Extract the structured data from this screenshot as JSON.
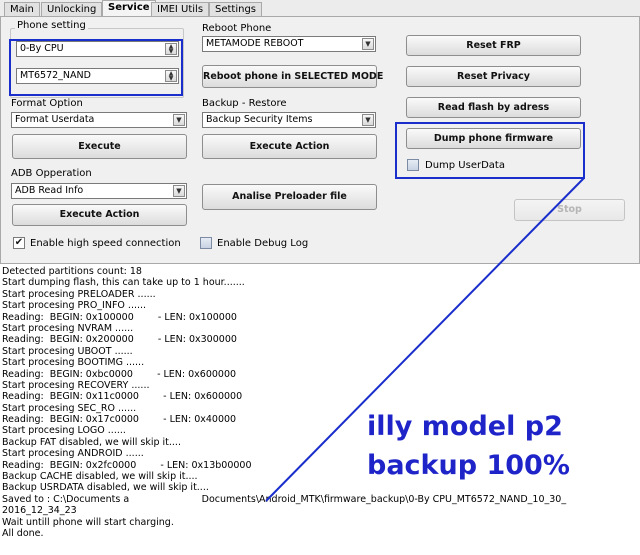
{
  "tabs": [
    "Main",
    "Unlocking",
    "Service",
    "IMEI Utils",
    "Settings"
  ],
  "phone_setting": {
    "title": "Phone setting",
    "cpu_value": "0-By CPU",
    "chip_value": "MT6572_NAND"
  },
  "reboot": {
    "title": "Reboot Phone",
    "mode_value": "METAMODE REBOOT",
    "button": "Reboot phone in SELECTED MODE"
  },
  "format": {
    "title": "Format Option",
    "value": "Format Userdata",
    "button": "Execute"
  },
  "backup": {
    "title": "Backup - Restore",
    "value": "Backup Security Items",
    "button": "Execute Action"
  },
  "adb": {
    "title": "ADB Opperation",
    "value": "ADB Read Info",
    "button": "Execute Action"
  },
  "preloader": {
    "button": "Analise Preloader file"
  },
  "right_buttons": {
    "reset_frp": "Reset FRP",
    "reset_privacy": "Reset Privacy",
    "read_flash": "Read flash by adress",
    "dump_firmware": "Dump phone firmware"
  },
  "dump_userdata": {
    "label": "Dump UserData",
    "checked": false
  },
  "stop": "Stop",
  "high_speed": {
    "label": "Enable high speed connection",
    "checked": true
  },
  "debug_log": {
    "label": "Enable Debug Log",
    "checked": false
  },
  "log": [
    "Detected partitions count: 18",
    "Start dumping flash, this can take up to 1 hour.......",
    "Start procesing PRELOADER ......",
    "Start procesing PRO_INFO ......",
    "Reading:  BEGIN: 0x100000        - LEN: 0x100000",
    "Start procesing NVRAM ......",
    "Reading:  BEGIN: 0x200000        - LEN: 0x300000",
    "Start procesing UBOOT ......",
    "Start procesing BOOTIMG ......",
    "Reading:  BEGIN: 0xbc0000        - LEN: 0x600000",
    "Start procesing RECOVERY ......",
    "Reading:  BEGIN: 0x11c0000        - LEN: 0x600000",
    "Start procesing SEC_RO ......",
    "Reading:  BEGIN: 0x17c0000        - LEN: 0x40000",
    "Start procesing LOGO ......",
    "Backup FAT disabled, we will skip it....",
    "Start procesing ANDROID ......",
    "Reading:  BEGIN: 0x2fc0000        - LEN: 0x13b00000",
    "Backup CACHE disabled, we will skip it....",
    "Backup USRDATA disabled, we will skip it....",
    "Saved to : C:\\Documents a                        Documents\\Android_MTK\\firmware_backup\\0-By CPU_MT6572_NAND_10_30_",
    "2016_12_34_23",
    "Wait untill phone will start charging.",
    "All done."
  ],
  "annotation": {
    "line1": "illy model p2",
    "line2": "backup 100%",
    "color": "#1e24c8"
  }
}
